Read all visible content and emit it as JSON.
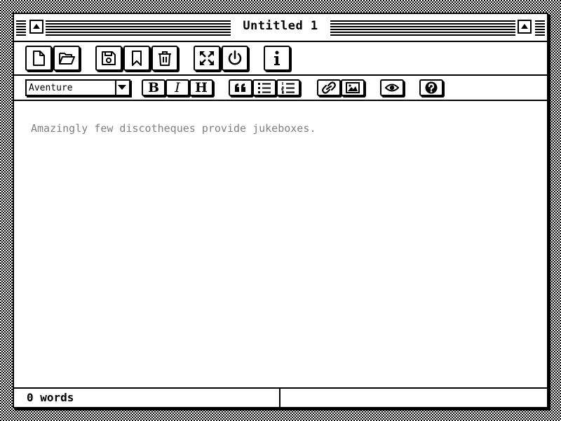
{
  "window": {
    "title": "Untitled 1"
  },
  "toolbar": {
    "buttons": [
      {
        "name": "new-file",
        "icon": "file-icon"
      },
      {
        "name": "open-folder",
        "icon": "folder-open-icon"
      },
      {
        "name": "save",
        "icon": "floppy-disk-icon"
      },
      {
        "name": "bookmark",
        "icon": "bookmark-icon"
      },
      {
        "name": "delete",
        "icon": "trash-icon"
      },
      {
        "name": "fullscreen",
        "icon": "expand-arrows-icon"
      },
      {
        "name": "quit",
        "icon": "power-icon"
      },
      {
        "name": "info",
        "icon": "info-icon"
      }
    ]
  },
  "format_bar": {
    "font_select": {
      "value": "Aventure"
    },
    "bold_label": "B",
    "italic_label": "I",
    "heading_label": "H",
    "buttons": [
      {
        "name": "quote",
        "icon": "quote-icon"
      },
      {
        "name": "bulleted-list",
        "icon": "list-bullet-icon"
      },
      {
        "name": "numbered-list",
        "icon": "list-numbered-icon"
      },
      {
        "name": "link",
        "icon": "link-icon"
      },
      {
        "name": "image",
        "icon": "image-icon"
      },
      {
        "name": "preview",
        "icon": "eye-icon"
      },
      {
        "name": "help",
        "icon": "question-icon"
      }
    ]
  },
  "editor": {
    "placeholder": "Amazingly few discotheques provide jukeboxes."
  },
  "status": {
    "word_count": "0 words",
    "right_text": ""
  },
  "colors": {
    "foreground": "#000000",
    "background": "#ffffff",
    "placeholder": "#808080"
  }
}
